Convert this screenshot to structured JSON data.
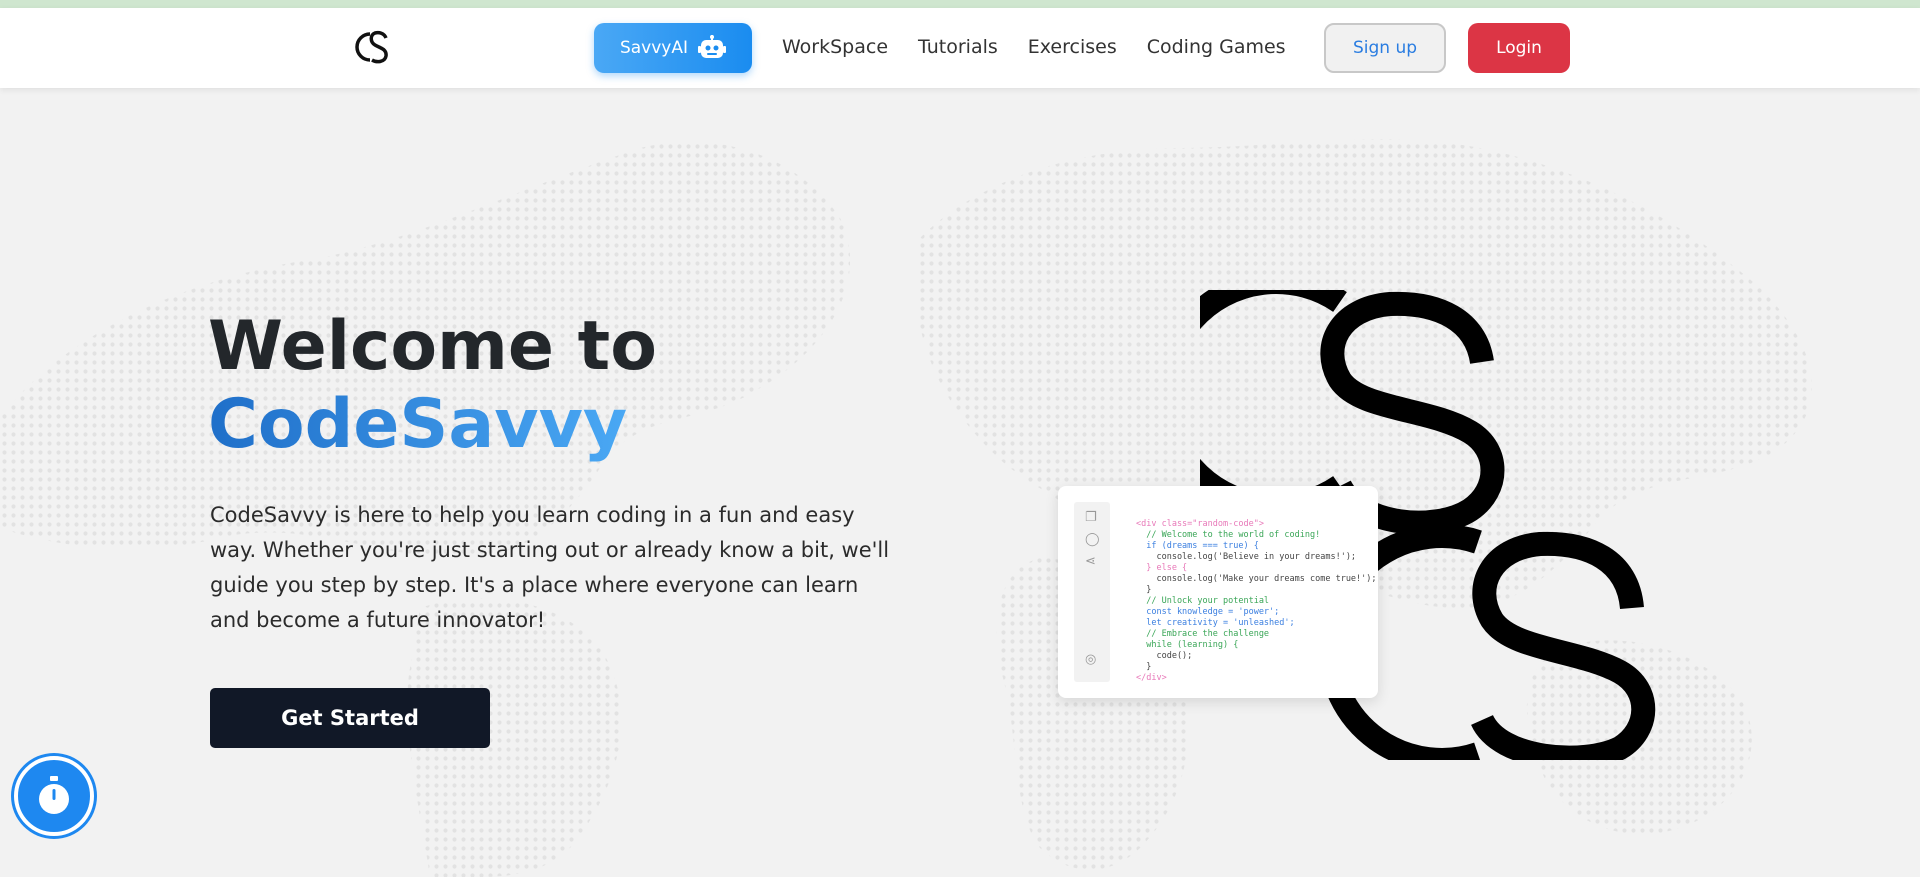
{
  "nav": {
    "ai_label": "SavvyAI",
    "links": [
      "WorkSpace",
      "Tutorials",
      "Exercises",
      "Coding Games"
    ],
    "signup_label": "Sign up",
    "login_label": "Login"
  },
  "hero": {
    "title_line1": "Welcome to",
    "title_line2": "CodeSavvy",
    "description": "CodeSavvy is here to help you learn coding in a fun and easy way. Whether you're just starting out or already know a bit, we'll guide you step by step. It's a place where everyone can learn and become a future innovator!",
    "cta_label": "Get Started"
  },
  "code_card": {
    "lines": [
      "<div class=\"random-code\">",
      "  // Welcome to the world of coding!",
      "  if (dreams === true) {",
      "    console.log('Believe in your dreams!');",
      "  } else {",
      "    console.log('Make your dreams come true!');",
      "  }",
      "  // Unlock your potential",
      "  const knowledge = 'power';",
      "  let creativity = 'unleashed';",
      "  // Embrace the challenge",
      "  while (learning) {",
      "    code();",
      "  }",
      "</div>"
    ]
  },
  "icons": {
    "logo": "cs-logo",
    "ai": "robot-icon",
    "timer": "stopwatch-icon"
  },
  "colors": {
    "accent": "#1a8cf0",
    "login": "#dc3545",
    "cta": "#111827",
    "brand_gradient_start": "#1f6fc9",
    "brand_gradient_end": "#4dacf7"
  }
}
